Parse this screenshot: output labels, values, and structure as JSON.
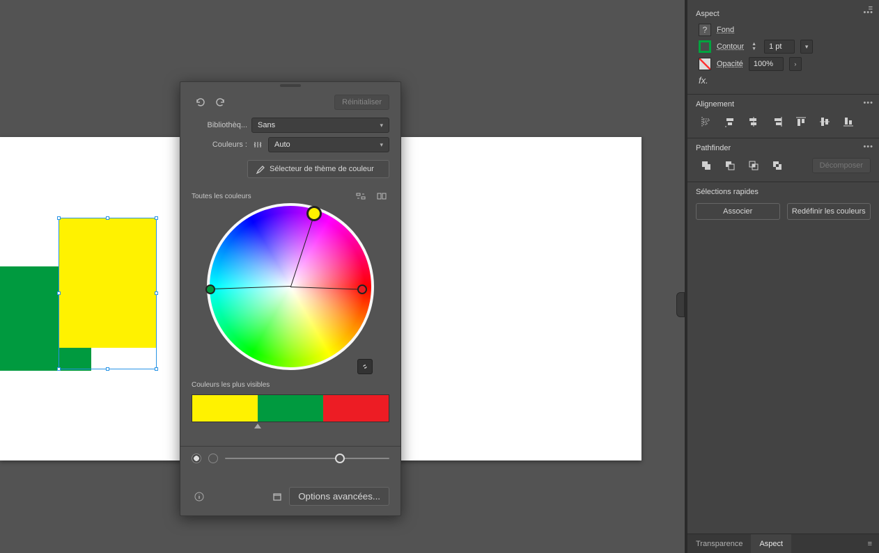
{
  "dialog": {
    "reset": "Réinitialiser",
    "library_label": "Bibliothèq...",
    "library_value": "Sans",
    "colors_label": "Couleurs :",
    "colors_value": "Auto",
    "theme_picker": "Sélecteur de thème de couleur",
    "all_colors": "Toutes les couleurs",
    "most_visible": "Couleurs les plus visibles",
    "swatches": [
      "#fff200",
      "#009a3f",
      "#ed1c24"
    ],
    "advanced": "Options avancées...",
    "nodes": [
      {
        "color": "#fff200",
        "angle": -72,
        "r": 110,
        "big": true
      },
      {
        "color": "#009a3f",
        "angle": 178,
        "r": 115,
        "big": false
      },
      {
        "color": "#ed1c24",
        "angle": 2,
        "r": 103,
        "big": false
      }
    ]
  },
  "sidepanel": {
    "aspect": {
      "title": "Aspect",
      "fond": "Fond",
      "contour": "Contour",
      "contour_value": "1 pt",
      "opacite": "Opacité",
      "opacite_value": "100%",
      "fx": "fx."
    },
    "align": {
      "title": "Alignement"
    },
    "pathfinder": {
      "title": "Pathfinder",
      "decompose": "Décomposer"
    },
    "quick": {
      "title": "Sélections rapides",
      "associer": "Associer",
      "redefinir": "Redéfinir les couleurs"
    },
    "tabs": {
      "transparence": "Transparence",
      "aspect": "Aspect"
    }
  }
}
